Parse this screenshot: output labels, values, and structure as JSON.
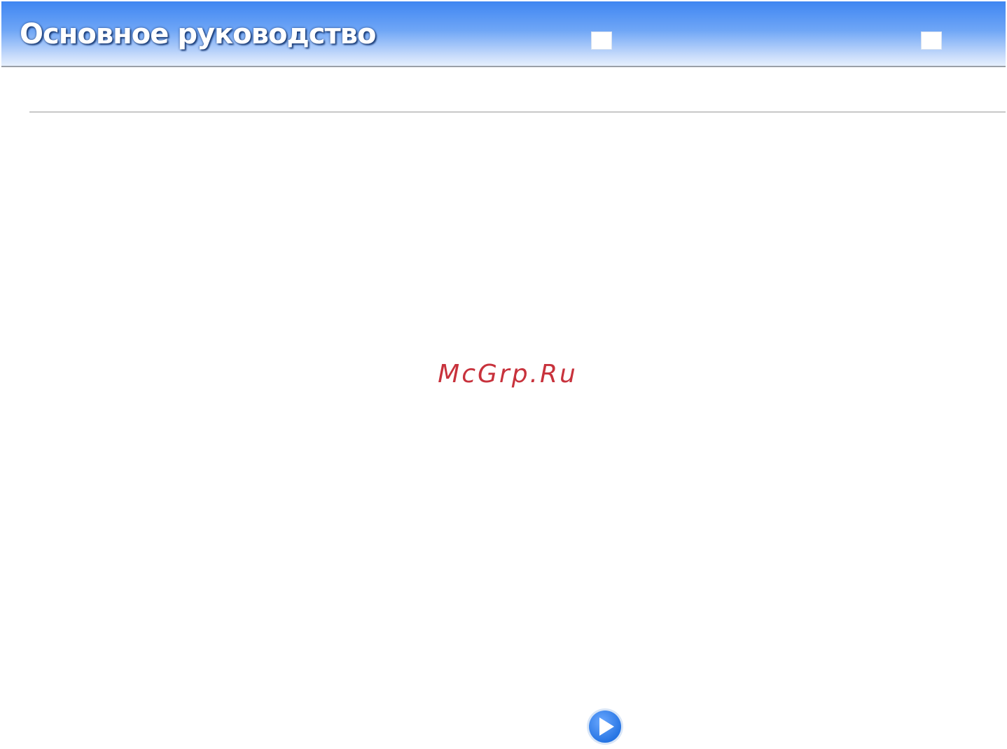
{
  "header": {
    "title": "Основное руководство",
    "accent_color": "#3f86f2"
  },
  "watermark": {
    "text": "McGrp.Ru",
    "color": "#c8323c"
  },
  "navigation": {
    "next_icon": "arrow-right-circle-icon",
    "icon_color": "#2f7fe6"
  }
}
